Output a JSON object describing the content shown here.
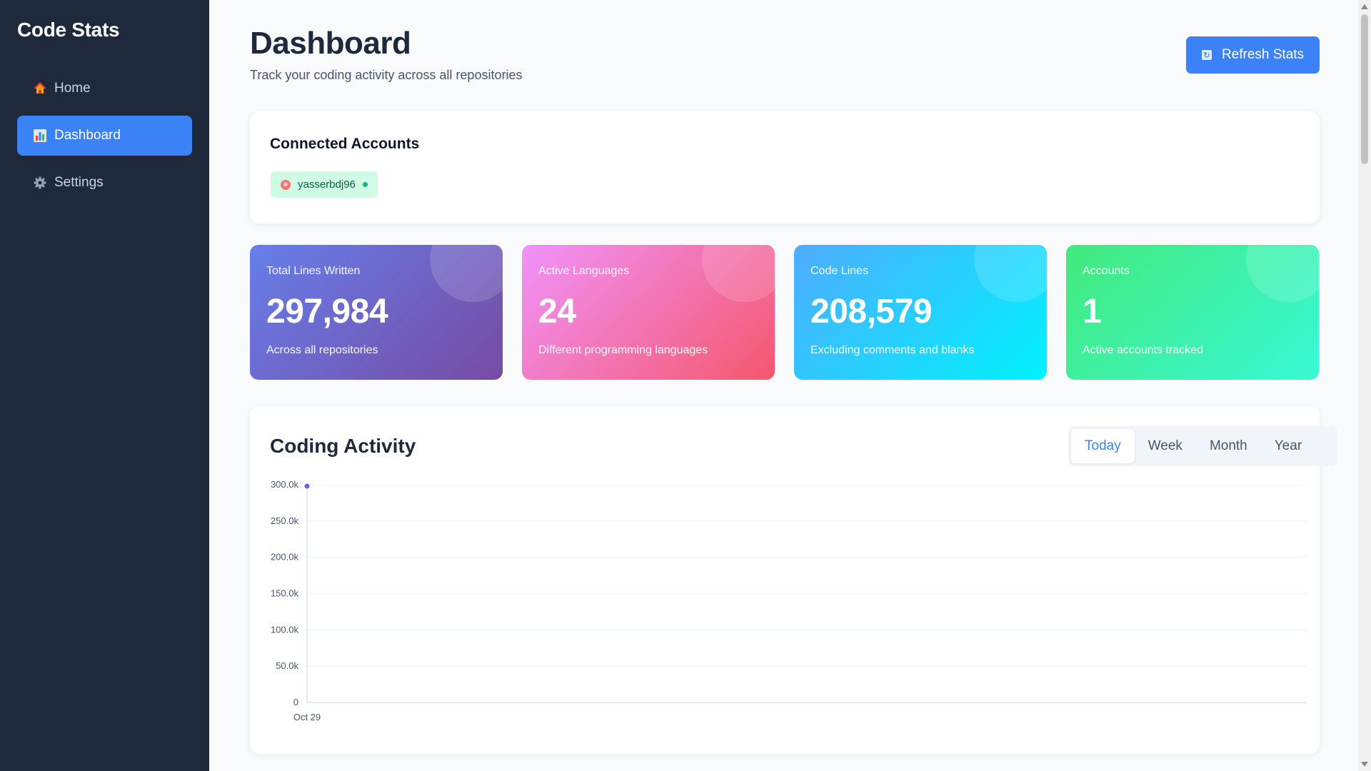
{
  "sidebar": {
    "brand": "Code Stats",
    "items": [
      {
        "label": "Home",
        "icon": "home-icon"
      },
      {
        "label": "Dashboard",
        "icon": "chart-icon",
        "active": true
      },
      {
        "label": "Settings",
        "icon": "gear-icon"
      }
    ]
  },
  "header": {
    "title": "Dashboard",
    "subtitle": "Track your coding activity across all repositories",
    "refresh_label": "Refresh Stats"
  },
  "accounts": {
    "title": "Connected Accounts",
    "items": [
      {
        "name": "yasserbdj96",
        "status_color": "#10b981"
      }
    ]
  },
  "stats": [
    {
      "label": "Total Lines Written",
      "value": "297,984",
      "desc": "Across all repositories"
    },
    {
      "label": "Active Languages",
      "value": "24",
      "desc": "Different programming languages"
    },
    {
      "label": "Code Lines",
      "value": "208,579",
      "desc": "Excluding comments and blanks"
    },
    {
      "label": "Accounts",
      "value": "1",
      "desc": "Active accounts tracked"
    }
  ],
  "activity": {
    "title": "Coding Activity",
    "periods": [
      "Today",
      "Week",
      "Month",
      "Year"
    ],
    "active_period": "Today"
  },
  "colors": {
    "sidebar_bg": "#1e293b",
    "accent": "#3b82f6",
    "chart_point": "#6366f1"
  },
  "chart_data": {
    "type": "line",
    "x": [
      "Oct 29"
    ],
    "series": [
      {
        "values": [
          297984
        ]
      }
    ],
    "ylim": [
      0,
      300000
    ],
    "yticks": [
      "0",
      "50.0k",
      "100.0k",
      "150.0k",
      "200.0k",
      "250.0k",
      "300.0k"
    ],
    "ytick_values": [
      0,
      50000,
      100000,
      150000,
      200000,
      250000,
      300000
    ],
    "grid": true
  }
}
